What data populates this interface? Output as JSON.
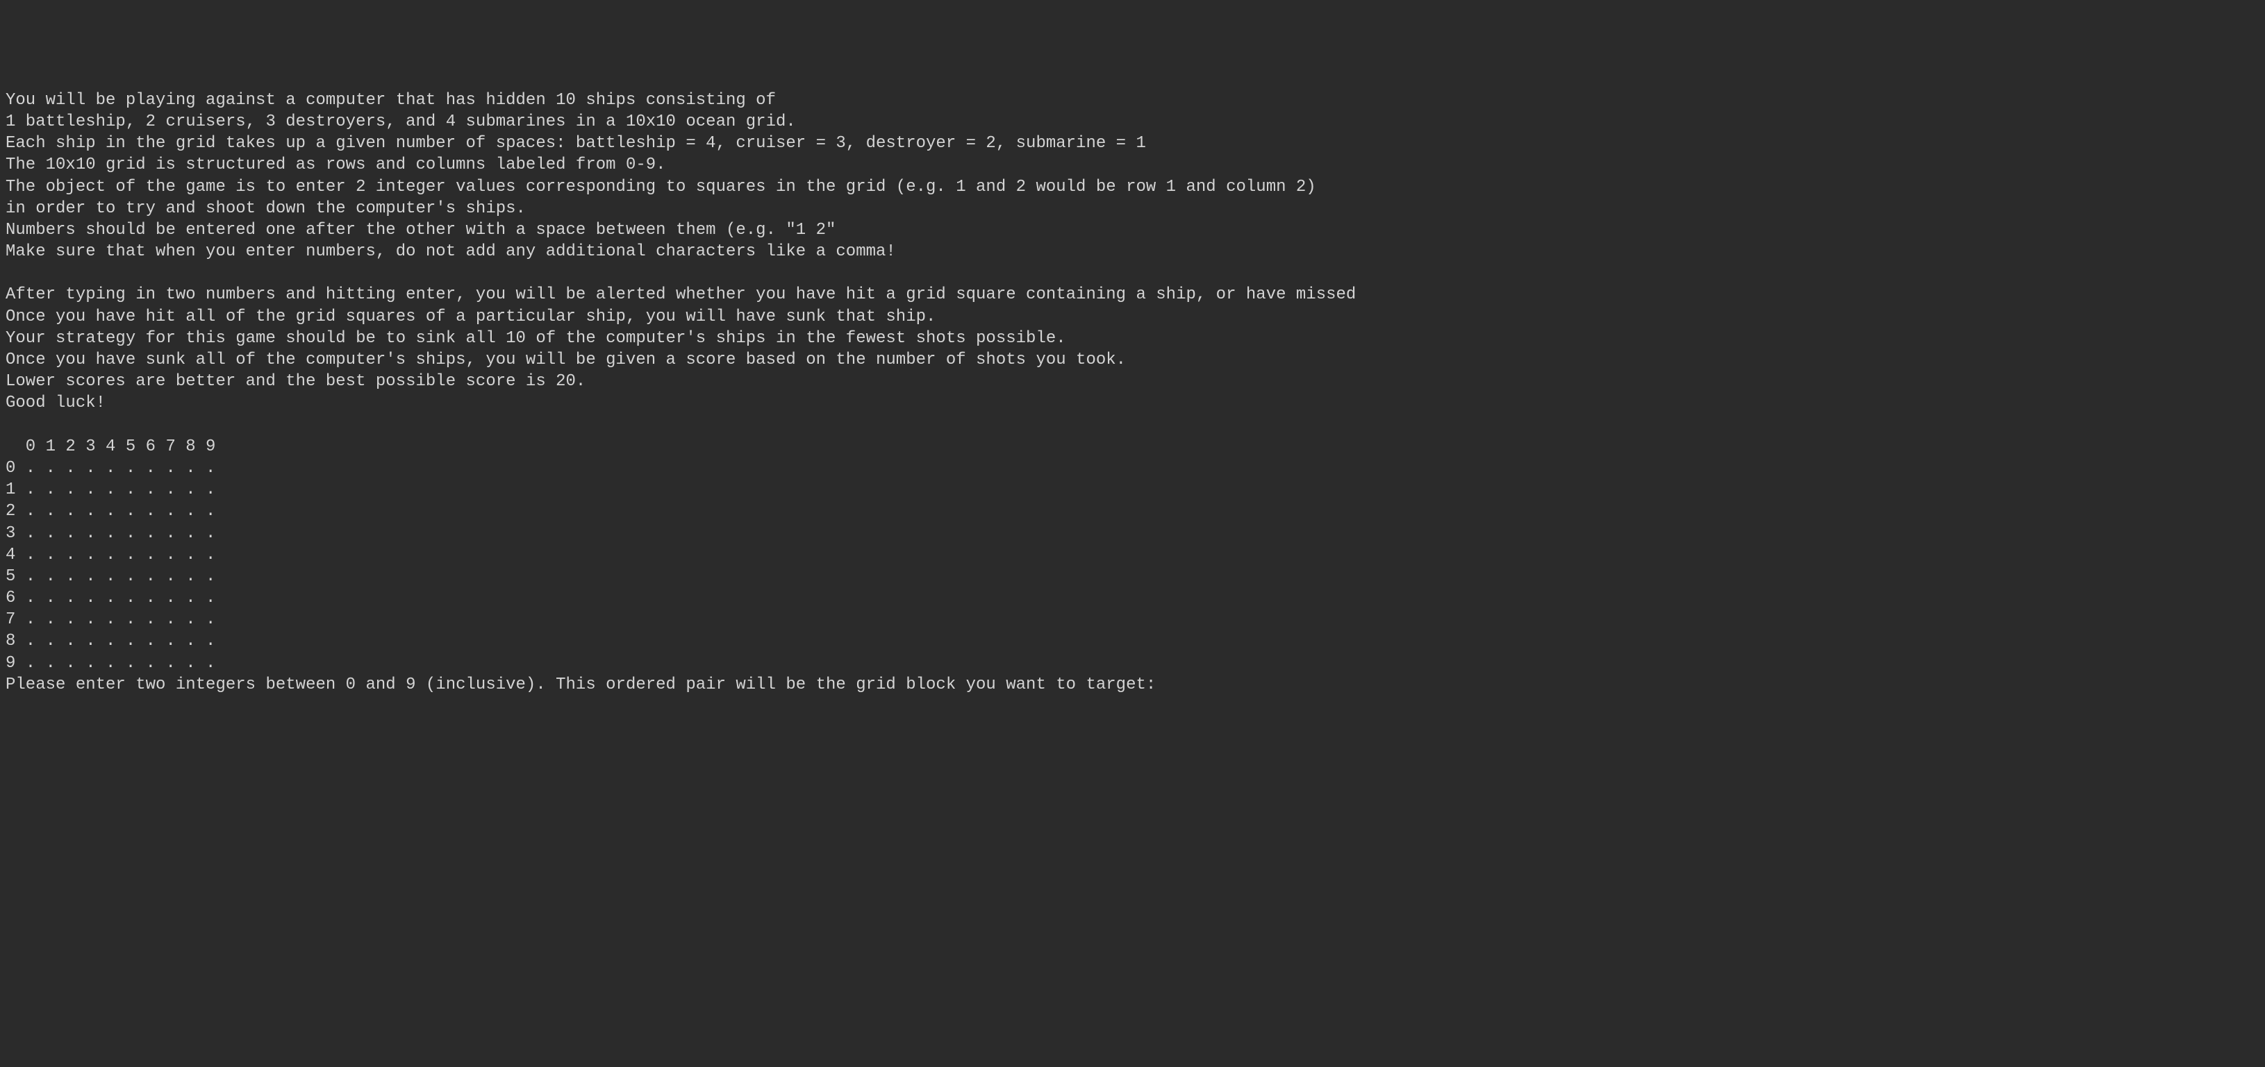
{
  "instructions": {
    "line1": "You will be playing against a computer that has hidden 10 ships consisting of",
    "line2": "1 battleship, 2 cruisers, 3 destroyers, and 4 submarines in a 10x10 ocean grid.",
    "line3": "Each ship in the grid takes up a given number of spaces: battleship = 4, cruiser = 3, destroyer = 2, submarine = 1",
    "line4": "The 10x10 grid is structured as rows and columns labeled from 0-9.",
    "line5": "The object of the game is to enter 2 integer values corresponding to squares in the grid (e.g. 1 and 2 would be row 1 and column 2)",
    "line6": "in order to try and shoot down the computer's ships.",
    "line7": "Numbers should be entered one after the other with a space between them (e.g. \"1 2\"",
    "line8": "Make sure that when you enter numbers, do not add any additional characters like a comma!",
    "line9": "",
    "line10": "After typing in two numbers and hitting enter, you will be alerted whether you have hit a grid square containing a ship, or have missed",
    "line11": "Once you have hit all of the grid squares of a particular ship, you will have sunk that ship.",
    "line12": "Your strategy for this game should be to sink all 10 of the computer's ships in the fewest shots possible.",
    "line13": "Once you have sunk all of the computer's ships, you will be given a score based on the number of shots you took.",
    "line14": "Lower scores are better and the best possible score is 20.",
    "line15": "Good luck!"
  },
  "grid": {
    "header": "  0 1 2 3 4 5 6 7 8 9",
    "row0": "0 . . . . . . . . . .",
    "row1": "1 . . . . . . . . . .",
    "row2": "2 . . . . . . . . . .",
    "row3": "3 . . . . . . . . . .",
    "row4": "4 . . . . . . . . . .",
    "row5": "5 . . . . . . . . . .",
    "row6": "6 . . . . . . . . . .",
    "row7": "7 . . . . . . . . . .",
    "row8": "8 . . . . . . . . . .",
    "row9": "9 . . . . . . . . . ."
  },
  "prompt": "Please enter two integers between 0 and 9 (inclusive). This ordered pair will be the grid block you want to target: "
}
